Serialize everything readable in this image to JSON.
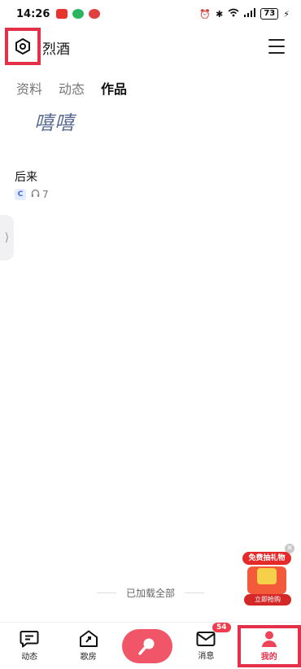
{
  "status_bar": {
    "time": "14:26",
    "battery": "73"
  },
  "header": {
    "title": "烈酒",
    "settings_icon": "gear-hexagon-icon",
    "menu_icon": "hamburger-menu-icon"
  },
  "tabs": [
    {
      "label": "资料",
      "active": false
    },
    {
      "label": "动态",
      "active": false
    },
    {
      "label": "作品",
      "active": true
    }
  ],
  "signature": "嘻嘻",
  "works": [
    {
      "title": "后来",
      "badge": "C",
      "listens": "7"
    }
  ],
  "side_handle": "⟩",
  "footer_text": "已加载全部",
  "promo": {
    "title": "免费抽礼物",
    "button": "立即抢购"
  },
  "bottom_nav": {
    "items": [
      {
        "label": "动态",
        "icon": "chat-bubble-icon"
      },
      {
        "label": "歌房",
        "icon": "house-icon"
      },
      {
        "label": "",
        "icon": "microphone-icon"
      },
      {
        "label": "消息",
        "icon": "mail-icon",
        "badge": "54"
      },
      {
        "label": "我的",
        "icon": "person-icon"
      }
    ]
  },
  "colors": {
    "accent": "#e5304a",
    "center_button": "#f05668",
    "badge": "#ef3d4d"
  }
}
